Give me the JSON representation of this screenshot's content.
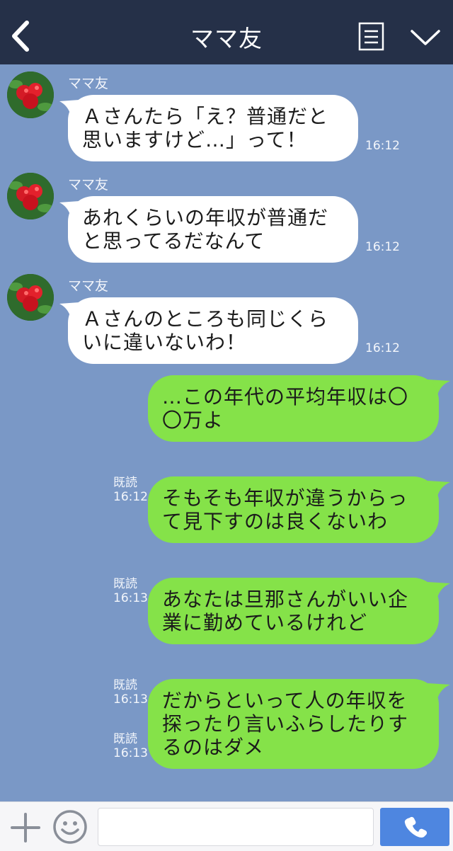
{
  "header": {
    "title": "ママ友",
    "back_icon": "back-chevron-icon",
    "menu_icon": "menu-document-icon",
    "dropdown_icon": "chevron-down-icon",
    "background": "#253048"
  },
  "chat": {
    "background": "#7a98c6",
    "messages": [
      {
        "direction": "incoming",
        "sender": "ママ友",
        "text_lines": [
          "Ａさんたら「え？普通だと",
          "思いますけど…」って！"
        ],
        "time": "16:12"
      },
      {
        "direction": "incoming",
        "sender": "ママ友",
        "text_lines": [
          "あれくらいの年収が普通だ",
          "と思ってるだなんて"
        ],
        "time": "16:12"
      },
      {
        "direction": "incoming",
        "sender": "ママ友",
        "text_lines": [
          "Ａさんのところも同じくら",
          "いに違いないわ！"
        ],
        "time": "16:12"
      },
      {
        "direction": "outgoing",
        "read": "既読",
        "text_lines": [
          "…この年代の平均年収は〇",
          "〇万よ"
        ],
        "time": "16:12"
      },
      {
        "direction": "outgoing",
        "read": "既読",
        "text_lines": [
          "そもそも年収が違うからっ",
          "て見下すのは良くないわ"
        ],
        "time": "16:13"
      },
      {
        "direction": "outgoing",
        "read": "既読",
        "text_lines": [
          "あなたは旦那さんがいい企",
          "業に勤めているけれど"
        ],
        "time": "16:13"
      },
      {
        "direction": "outgoing",
        "read": "既読",
        "text_lines": [
          "だからといって人の年収を",
          "探ったり言いふらしたりす",
          "るのはダメ"
        ],
        "time": "16:13"
      }
    ],
    "incoming_color": "#ffffff",
    "outgoing_color": "#85e249"
  },
  "footer": {
    "plus_icon": "plus-icon",
    "emoji_icon": "smile-icon",
    "input_value": "",
    "call_icon": "phone-icon",
    "call_color": "#4e86e0"
  }
}
